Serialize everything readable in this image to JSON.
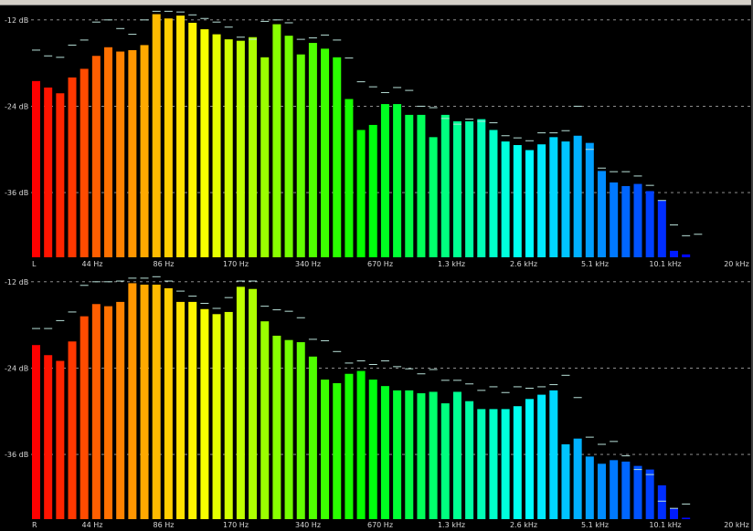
{
  "chart_data": [
    {
      "type": "bar",
      "channel_label": "L",
      "y_ticks": [
        "-12 dB",
        "-24 dB",
        "-36 dB"
      ],
      "y_tick_values": [
        -12,
        -24,
        -36
      ],
      "x_ticks": [
        "44 Hz",
        "86 Hz",
        "170 Hz",
        "340 Hz",
        "670 Hz",
        "1.3 kHz",
        "2.6 kHz",
        "5.1 kHz",
        "10.1 kHz",
        "20 kHz"
      ],
      "ylim": [
        -45,
        -10.5
      ],
      "grid": true,
      "values": [
        -20.5,
        -21.4,
        -22.2,
        -20.0,
        -18.8,
        -17.0,
        -15.8,
        -16.4,
        -16.2,
        -15.5,
        -11.2,
        -11.8,
        -11.4,
        -12.4,
        -13.3,
        -14.0,
        -14.7,
        -14.9,
        -14.4,
        -17.2,
        -12.6,
        -14.2,
        -16.8,
        -15.2,
        -16.0,
        -17.2,
        -23.0,
        -27.3,
        -26.6,
        -23.7,
        -23.7,
        -25.2,
        -25.2,
        -28.3,
        -25.2,
        -26.1,
        -26.1,
        -25.8,
        -27.3,
        -28.9,
        -29.4,
        -30.1,
        -29.3,
        -28.3,
        -28.9,
        -28.1,
        -29.1,
        -33.0,
        -34.6,
        -35.1,
        -34.8,
        -35.8,
        -37.1,
        -44.1,
        -44.6
      ],
      "peaks": [
        -16.2,
        -17.0,
        -17.2,
        -15.5,
        -14.8,
        -12.3,
        -12.0,
        -13.2,
        -14.0,
        -12.0,
        -10.8,
        -10.8,
        -10.9,
        -11.3,
        -11.8,
        -12.3,
        -13.0,
        -14.4,
        -14.7,
        -12.2,
        -12.0,
        -12.4,
        -14.7,
        -14.5,
        -14.1,
        -14.8,
        -17.3,
        -20.6,
        -21.3,
        -22.1,
        -21.4,
        -21.8,
        -24.0,
        -24.2,
        -25.7,
        -26.5,
        -25.8,
        -26.1,
        -26.3,
        -28.1,
        -28.4,
        -28.8,
        -27.7,
        -27.7,
        -27.4,
        -24.0,
        -30.0,
        -32.6,
        -33.1,
        -33.1,
        -33.7,
        -35.0,
        -37.1,
        -40.5,
        -42.0,
        -41.8
      ]
    },
    {
      "type": "bar",
      "channel_label": "R",
      "y_ticks": [
        "-12 dB",
        "-24 dB",
        "-36 dB"
      ],
      "y_tick_values": [
        -12,
        -24,
        -36
      ],
      "x_ticks": [
        "44 Hz",
        "86 Hz",
        "170 Hz",
        "340 Hz",
        "670 Hz",
        "1.3 kHz",
        "2.6 kHz",
        "5.1 kHz",
        "10.1 kHz",
        "20 kHz"
      ],
      "ylim": [
        -45,
        -10.5
      ],
      "grid": true,
      "values": [
        -20.8,
        -22.2,
        -23.0,
        -20.3,
        -16.8,
        -15.1,
        -15.4,
        -14.8,
        -12.2,
        -12.4,
        -12.4,
        -12.9,
        -14.8,
        -14.8,
        -15.8,
        -16.5,
        -16.2,
        -12.7,
        -13.0,
        -17.5,
        -19.5,
        -20.1,
        -20.4,
        -22.4,
        -25.6,
        -26.1,
        -24.8,
        -24.4,
        -25.6,
        -26.5,
        -27.1,
        -27.1,
        -27.5,
        -27.3,
        -28.9,
        -27.3,
        -28.6,
        -29.7,
        -29.7,
        -29.7,
        -29.3,
        -28.3,
        -27.7,
        -27.1,
        -34.6,
        -33.8,
        -36.3,
        -37.3,
        -36.8,
        -37.0,
        -37.6,
        -38.1,
        -40.3,
        -43.5,
        -44.8
      ],
      "peaks": [
        -18.5,
        -18.5,
        -17.4,
        -16.2,
        -12.5,
        -12.0,
        -12.0,
        -11.9,
        -11.5,
        -11.5,
        -11.3,
        -11.9,
        -13.3,
        -14.0,
        -15.0,
        -15.7,
        -14.2,
        -11.9,
        -11.9,
        -15.4,
        -15.9,
        -16.1,
        -17.0,
        -20.0,
        -20.2,
        -21.7,
        -23.3,
        -23.0,
        -23.5,
        -23.0,
        -23.8,
        -24.1,
        -24.8,
        -24.2,
        -25.7,
        -25.7,
        -26.2,
        -27.1,
        -26.6,
        -27.4,
        -26.6,
        -26.8,
        -26.6,
        -26.3,
        -25.0,
        -28.1,
        -33.6,
        -34.6,
        -34.2,
        -36.2,
        -38.1,
        -38.8,
        -42.5,
        -43.5,
        -42.9
      ]
    }
  ],
  "colors": {
    "background": "#000000",
    "grid": "#a0a0a0",
    "peak_marker": "#b8e0d8",
    "label": "#d8d8d8",
    "spectrum_start": "#ff0000",
    "spectrum_mid": "#ffff00",
    "spectrum_end": "#0000ff"
  }
}
